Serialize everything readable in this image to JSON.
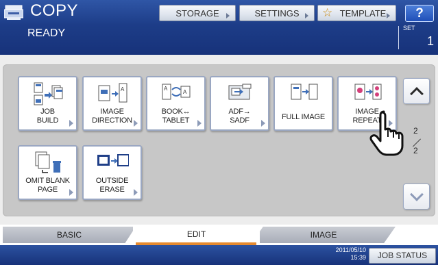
{
  "header": {
    "title": "COPY",
    "status": "READY",
    "set_label": "SET",
    "set_count": "1",
    "buttons": {
      "storage": "STORAGE",
      "settings": "SETTINGS",
      "template": "TEMPLATE",
      "help": "?"
    }
  },
  "functions": [
    {
      "id": "job-build",
      "line1": "JOB",
      "line2": "BUILD",
      "icon": "job-build-icon"
    },
    {
      "id": "image-direction",
      "line1": "IMAGE",
      "line2": "DIRECTION",
      "icon": "image-direction-icon"
    },
    {
      "id": "book-tablet",
      "line1": "BOOK↔",
      "line2": "TABLET",
      "icon": "book-tablet-icon"
    },
    {
      "id": "adf-sadf",
      "line1": "ADF→",
      "line2": "SADF",
      "icon": "adf-sadf-icon"
    },
    {
      "id": "full-image",
      "line1": "FULL IMAGE",
      "line2": "",
      "icon": "full-image-icon"
    },
    {
      "id": "image-repeat",
      "line1": "IMAGE",
      "line2": "REPEAT",
      "icon": "image-repeat-icon"
    },
    {
      "id": "omit-blank-page",
      "line1": "OMIT BLANK",
      "line2": "PAGE",
      "icon": "omit-blank-page-icon"
    },
    {
      "id": "outside-erase",
      "line1": "OUTSIDE",
      "line2": "ERASE",
      "icon": "outside-erase-icon"
    }
  ],
  "pager": {
    "current": "2",
    "total": "2"
  },
  "tabs": {
    "basic": "BASIC",
    "edit": "EDIT",
    "image": "IMAGE",
    "active": "EDIT"
  },
  "footer": {
    "date": "2011/05/10",
    "time": "15:39",
    "job_status": "JOB STATUS"
  },
  "colors": {
    "header_blue": "#1d3d88",
    "active_tab_accent": "#e68a2e",
    "help_blue": "#2f60c8"
  }
}
